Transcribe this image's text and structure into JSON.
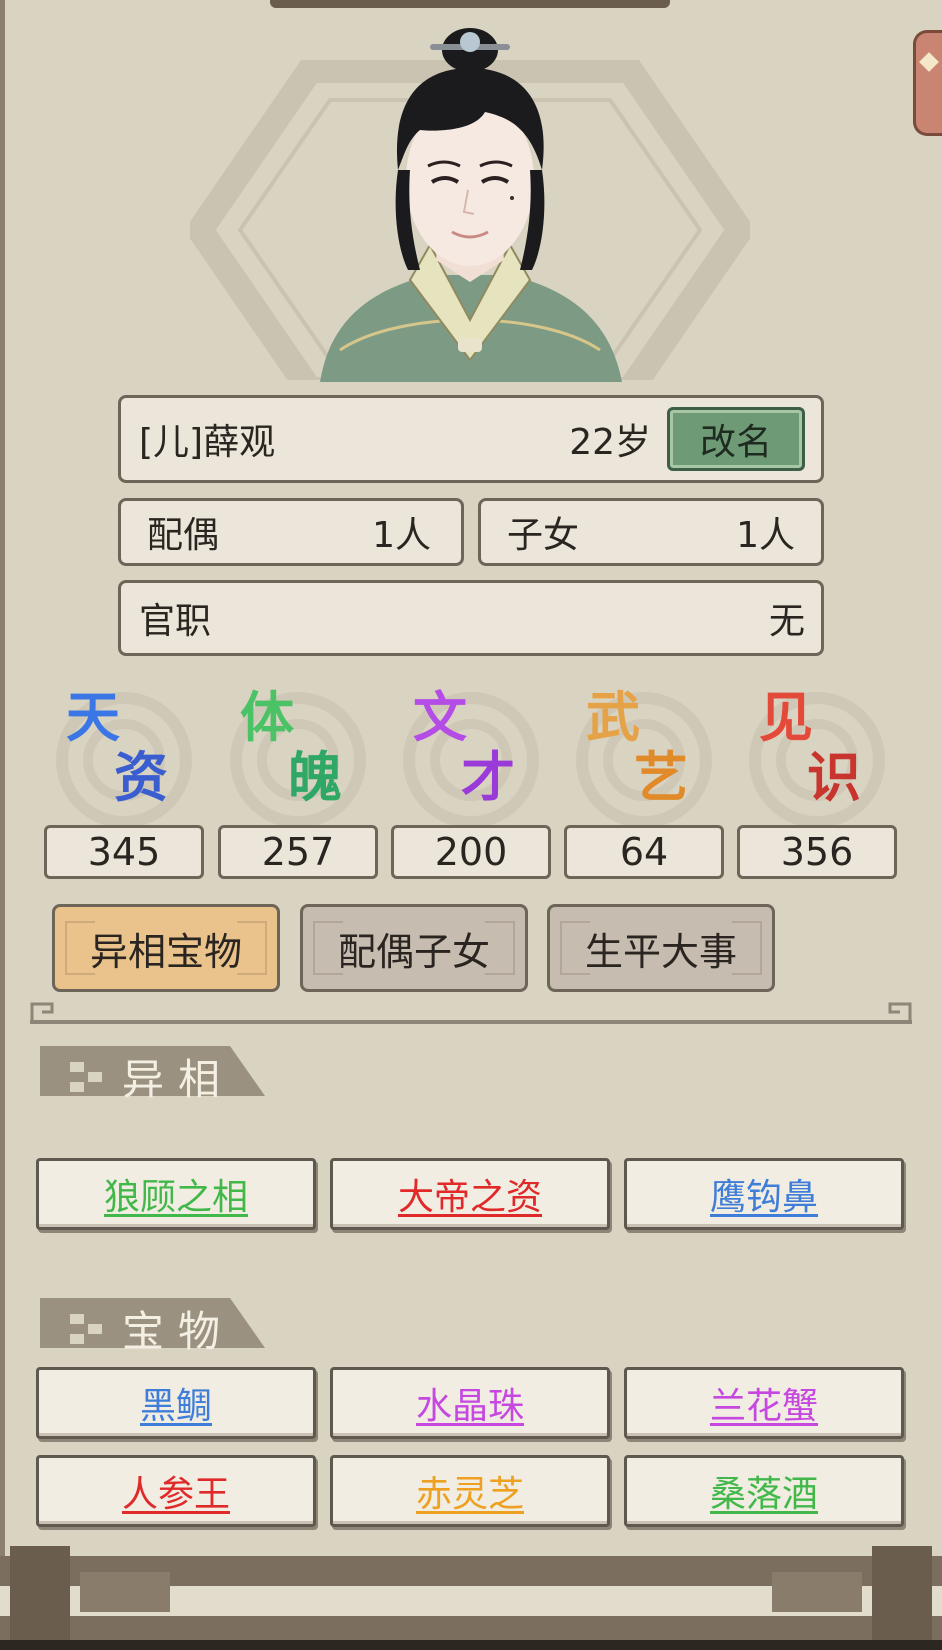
{
  "character": {
    "name": "[儿]薛观",
    "age": "22岁",
    "rename_label": "改名",
    "spouse_label": "配偶",
    "spouse_count": "1人",
    "children_label": "子女",
    "children_count": "1人",
    "office_label": "官职",
    "office_value": "无"
  },
  "stats": [
    {
      "c1": "天",
      "c2": "资",
      "value": "345",
      "color1": "#3a76e6",
      "color2": "#3a5ed0"
    },
    {
      "c1": "体",
      "c2": "魄",
      "value": "257",
      "color1": "#4cc266",
      "color2": "#2fa866"
    },
    {
      "c1": "文",
      "c2": "才",
      "value": "200",
      "color1": "#b44de6",
      "color2": "#9a3ad8"
    },
    {
      "c1": "武",
      "c2": "艺",
      "value": "64",
      "color1": "#e6a246",
      "color2": "#e08a2a"
    },
    {
      "c1": "见",
      "c2": "识",
      "value": "356",
      "color1": "#e44a3a",
      "color2": "#c8342e"
    }
  ],
  "tabs": [
    {
      "label": "异相宝物",
      "active": true
    },
    {
      "label": "配偶子女",
      "active": false
    },
    {
      "label": "生平大事",
      "active": false
    }
  ],
  "traits_section": {
    "title": "异相",
    "items": [
      {
        "label": "狼顾之相",
        "color": "#43b84a"
      },
      {
        "label": "大帝之资",
        "color": "#e02a2a"
      },
      {
        "label": "鹰钩鼻",
        "color": "#3f7ed8"
      }
    ]
  },
  "treasures_section": {
    "title": "宝物",
    "items": [
      {
        "label": "黑鲷",
        "color": "#3f7ed8"
      },
      {
        "label": "水晶珠",
        "color": "#c648e0"
      },
      {
        "label": "兰花蟹",
        "color": "#c648e0"
      },
      {
        "label": "人参王",
        "color": "#e02a2a"
      },
      {
        "label": "赤灵芝",
        "color": "#eea020"
      },
      {
        "label": "桑落酒",
        "color": "#43b84a"
      }
    ]
  }
}
